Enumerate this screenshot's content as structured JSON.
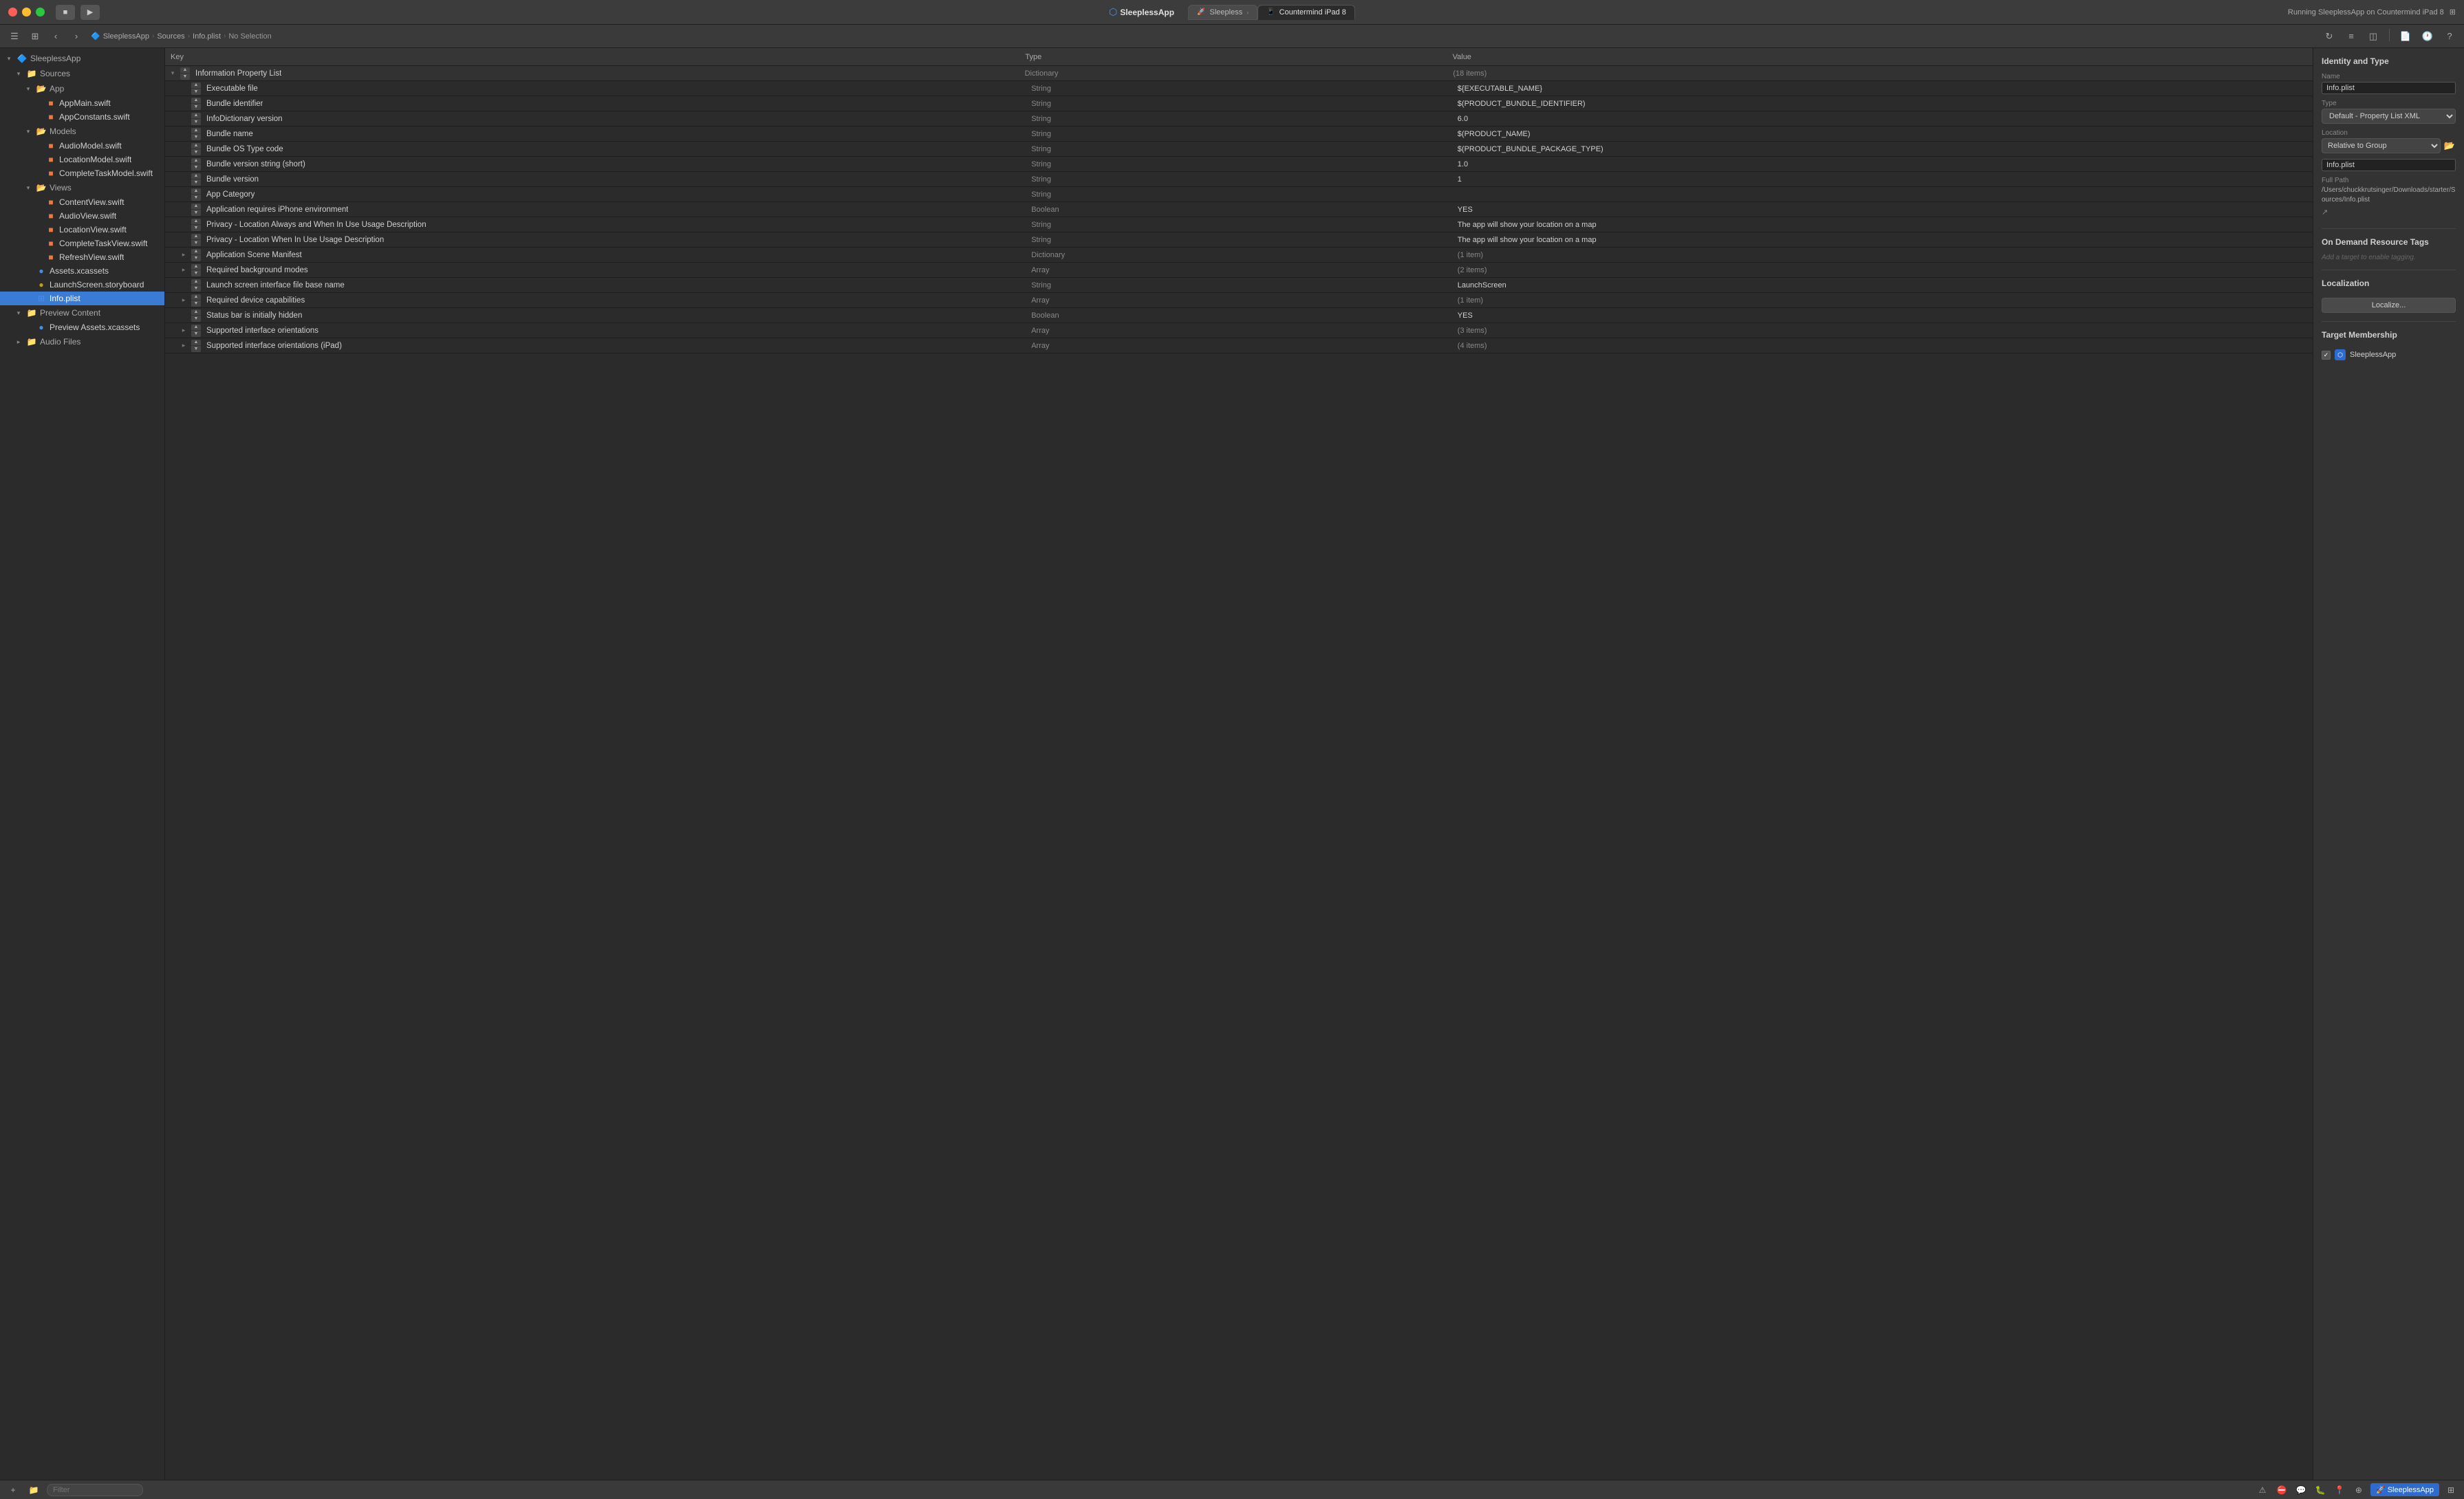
{
  "titlebar": {
    "app_name": "SleeplessApp",
    "run_status": "Running SleeplessApp on Countermind iPad 8",
    "tabs": [
      {
        "id": "sleepless",
        "label": "Sleepless",
        "icon": "🚀"
      },
      {
        "id": "countermind",
        "label": "Countermind iPad 8",
        "icon": "📱",
        "active": true
      }
    ]
  },
  "toolbar": {
    "breadcrumb": [
      {
        "label": "SleeplessApp",
        "icon": "🔷"
      },
      {
        "label": "Sources"
      },
      {
        "label": "Info.plist"
      },
      {
        "label": "No Selection"
      }
    ]
  },
  "sidebar": {
    "title": "SleeplessApp",
    "groups": [
      {
        "id": "sources",
        "label": "Sources",
        "icon": "📁",
        "open": true,
        "children": [
          {
            "id": "app",
            "label": "App",
            "icon": "📂",
            "open": true,
            "children": [
              {
                "id": "appmain",
                "label": "AppMain.swift",
                "icon": "🟠"
              },
              {
                "id": "appconstants",
                "label": "AppConstants.swift",
                "icon": "🟠"
              }
            ]
          },
          {
            "id": "models",
            "label": "Models",
            "icon": "📂",
            "open": true,
            "children": [
              {
                "id": "audiomodel",
                "label": "AudioModel.swift",
                "icon": "🟠"
              },
              {
                "id": "locationmodel",
                "label": "LocationModel.swift",
                "icon": "🟠"
              },
              {
                "id": "completetaskmodel",
                "label": "CompleteTaskModel.swift",
                "icon": "🟠"
              }
            ]
          },
          {
            "id": "views",
            "label": "Views",
            "icon": "📂",
            "open": true,
            "children": [
              {
                "id": "contentview",
                "label": "ContentView.swift",
                "icon": "🟠"
              },
              {
                "id": "audioview",
                "label": "AudioView.swift",
                "icon": "🟠"
              },
              {
                "id": "locationview",
                "label": "LocationView.swift",
                "icon": "🟠"
              },
              {
                "id": "completetaskview",
                "label": "CompleteTaskView.swift",
                "icon": "🟠"
              },
              {
                "id": "refreshview",
                "label": "RefreshView.swift",
                "icon": "🟠"
              }
            ]
          },
          {
            "id": "assets",
            "label": "Assets.xcassets",
            "icon": "🔵"
          },
          {
            "id": "launchscreen",
            "label": "LaunchScreen.storyboard",
            "icon": "🟡"
          },
          {
            "id": "infoplist",
            "label": "Info.plist",
            "icon": "🔷",
            "selected": true
          }
        ]
      },
      {
        "id": "previewcontent",
        "label": "Preview Content",
        "icon": "📁",
        "open": true,
        "children": [
          {
            "id": "previewassets",
            "label": "Preview Assets.xcassets",
            "icon": "🔵"
          }
        ]
      },
      {
        "id": "audiofiles",
        "label": "Audio Files",
        "icon": "📁",
        "open": false,
        "children": []
      }
    ]
  },
  "plist": {
    "columns": {
      "key": "Key",
      "type": "Type",
      "value": "Value"
    },
    "rows": [
      {
        "id": "root",
        "indent": 0,
        "disclosure": "open",
        "key": "Information Property List",
        "type": "Dictionary",
        "value": "(18 items)",
        "value_gray": true,
        "stepper": true
      },
      {
        "id": "executable",
        "indent": 1,
        "disclosure": "none",
        "key": "Executable file",
        "type": "String",
        "value": "${EXECUTABLE_NAME}",
        "stepper": true
      },
      {
        "id": "bundle_id",
        "indent": 1,
        "disclosure": "none",
        "key": "Bundle identifier",
        "type": "String",
        "value": "$(PRODUCT_BUNDLE_IDENTIFIER)",
        "stepper": true
      },
      {
        "id": "infodictionary",
        "indent": 1,
        "disclosure": "none",
        "key": "InfoDictionary version",
        "type": "String",
        "value": "6.0",
        "stepper": true
      },
      {
        "id": "bundle_name",
        "indent": 1,
        "disclosure": "none",
        "key": "Bundle name",
        "type": "String",
        "value": "$(PRODUCT_NAME)",
        "stepper": true
      },
      {
        "id": "bundle_os_type",
        "indent": 1,
        "disclosure": "none",
        "key": "Bundle OS Type code",
        "type": "String",
        "value": "$(PRODUCT_BUNDLE_PACKAGE_TYPE)",
        "stepper": true
      },
      {
        "id": "bundle_version_short",
        "indent": 1,
        "disclosure": "none",
        "key": "Bundle version string (short)",
        "type": "String",
        "value": "1.0",
        "stepper": true
      },
      {
        "id": "bundle_version",
        "indent": 1,
        "disclosure": "none",
        "key": "Bundle version",
        "type": "String",
        "value": "1",
        "stepper": true
      },
      {
        "id": "app_category",
        "indent": 1,
        "disclosure": "none",
        "key": "App Category",
        "type": "String",
        "value": "",
        "stepper": true
      },
      {
        "id": "requires_iphone",
        "indent": 1,
        "disclosure": "none",
        "key": "Application requires iPhone environment",
        "type": "Boolean",
        "value": "YES",
        "stepper": true
      },
      {
        "id": "privacy_always",
        "indent": 1,
        "disclosure": "none",
        "key": "Privacy - Location Always and When In Use Usage Description",
        "type": "String",
        "value": "The app will show your location on a map",
        "stepper": true
      },
      {
        "id": "privacy_when",
        "indent": 1,
        "disclosure": "none",
        "key": "Privacy - Location When In Use Usage Description",
        "type": "String",
        "value": "The app will show your location on a map",
        "stepper": true
      },
      {
        "id": "app_scene",
        "indent": 1,
        "disclosure": "closed",
        "key": "Application Scene Manifest",
        "type": "Dictionary",
        "value": "(1 item)",
        "value_gray": true,
        "stepper": true
      },
      {
        "id": "required_bg",
        "indent": 1,
        "disclosure": "closed",
        "key": "Required background modes",
        "type": "Array",
        "value": "(2 items)",
        "value_gray": true,
        "stepper": true
      },
      {
        "id": "launch_screen",
        "indent": 1,
        "disclosure": "none",
        "key": "Launch screen interface file base name",
        "type": "String",
        "value": "LaunchScreen",
        "stepper": true
      },
      {
        "id": "required_device",
        "indent": 1,
        "disclosure": "closed",
        "key": "Required device capabilities",
        "type": "Array",
        "value": "(1 item)",
        "value_gray": true,
        "stepper": true
      },
      {
        "id": "status_bar",
        "indent": 1,
        "disclosure": "none",
        "key": "Status bar is initially hidden",
        "type": "Boolean",
        "value": "YES",
        "stepper": true
      },
      {
        "id": "supported_orient",
        "indent": 1,
        "disclosure": "closed",
        "key": "Supported interface orientations",
        "type": "Array",
        "value": "(3 items)",
        "value_gray": true,
        "stepper": true
      },
      {
        "id": "supported_orient_ipad",
        "indent": 1,
        "disclosure": "closed",
        "key": "Supported interface orientations (iPad)",
        "type": "Array",
        "value": "(4 items)",
        "value_gray": true,
        "stepper": true
      }
    ]
  },
  "right_panel": {
    "identity_type": {
      "title": "Identity and Type",
      "name_label": "Name",
      "name_value": "Info.plist",
      "type_label": "Type",
      "type_value": "Default - Property List XML",
      "location_label": "Location",
      "location_value": "Relative to Group",
      "path_value": "Info.plist",
      "full_path_label": "Full Path",
      "full_path_value": "/Users/chuckkrutsinger/Downloads/starter/Sources/Info.plist"
    },
    "on_demand": {
      "title": "On Demand Resource Tags",
      "placeholder": "Add a target to enable tagging."
    },
    "localization": {
      "title": "Localization",
      "button_label": "Localize..."
    },
    "target_membership": {
      "title": "Target Membership",
      "targets": [
        {
          "id": "sleeplessapp",
          "name": "SleeplessApp",
          "checked": true
        }
      ]
    }
  },
  "bottom_bar": {
    "filter_placeholder": "Filter",
    "scheme_label": "SleeplessApp"
  }
}
